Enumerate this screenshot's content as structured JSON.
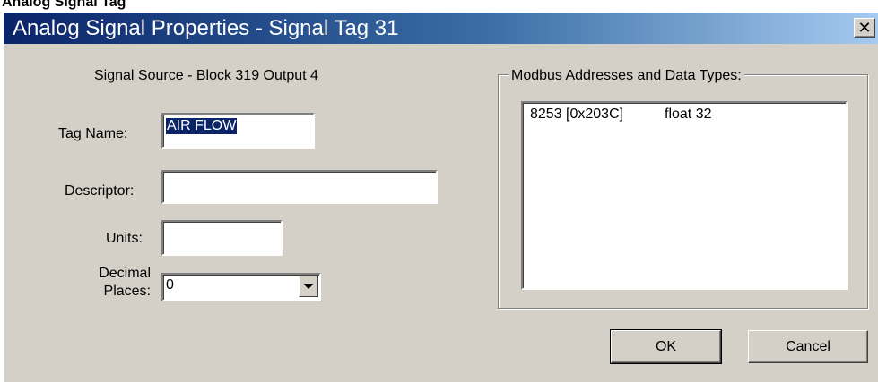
{
  "caption": "Analog Signal Tag",
  "window": {
    "title": "Analog Signal Properties - Signal Tag 31",
    "close_symbol": "✕"
  },
  "signal_source": "Signal Source - Block 319  Output 4",
  "fields": {
    "tag_name": {
      "label": "Tag Name:",
      "value": "AIR FLOW"
    },
    "descriptor": {
      "label": "Descriptor:",
      "value": ""
    },
    "units": {
      "label": "Units:",
      "value": ""
    },
    "decimal_places": {
      "label_line1": "Decimal",
      "label_line2": "Places:",
      "value": "0"
    }
  },
  "modbus": {
    "legend": "Modbus Addresses and Data Types:",
    "rows": [
      {
        "address": "8253 [0x203C]",
        "type": "float 32"
      }
    ]
  },
  "buttons": {
    "ok": "OK",
    "cancel": "Cancel"
  },
  "icons": {
    "close": "close-icon",
    "dropdown": "chevron-down-icon"
  }
}
